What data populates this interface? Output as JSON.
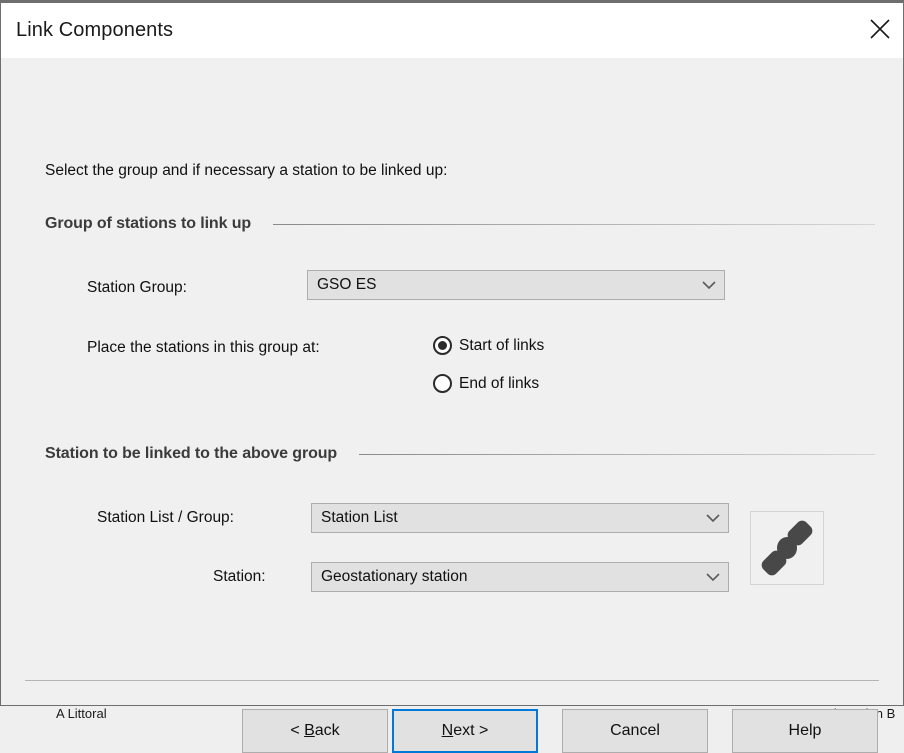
{
  "window": {
    "title": "Link Components",
    "close_icon": "close-icon"
  },
  "body": {
    "intro": "Select the group and if necessary a station to be linked up:"
  },
  "sections": [
    {
      "id": "group-of-stations",
      "title": "Group of stations to link up"
    },
    {
      "id": "station-to-be-linked",
      "title": "Station to be linked to the above group"
    }
  ],
  "fields": {
    "station_group": {
      "label": "Station Group:",
      "value": "GSO ES",
      "arrow_icon": "chevron-down-icon"
    },
    "place_stations": {
      "label": "Place the stations in this group at:",
      "options": [
        {
          "label": "Start of links",
          "selected": true
        },
        {
          "label": "End of links",
          "selected": false
        }
      ]
    },
    "station_list_group": {
      "label": "Station List / Group:",
      "value": "Station List",
      "arrow_icon": "chevron-down-icon"
    },
    "station": {
      "label": "Station:",
      "value": "Geostationary station",
      "arrow_icon": "chevron-down-icon"
    },
    "link_icon_button": {
      "icon": "link-chain-icon"
    }
  },
  "footer": {
    "buttons": [
      {
        "id": "back",
        "prefix": "< ",
        "accel": "B",
        "suffix": "ack",
        "default": false
      },
      {
        "id": "next",
        "prefix": "",
        "accel": "N",
        "suffix": "ext >",
        "default": true
      },
      {
        "id": "cancel",
        "prefix": "",
        "accel": "",
        "suffix": "Cancel",
        "default": false
      },
      {
        "id": "help",
        "prefix": "",
        "accel": "",
        "suffix": "Help",
        "default": false
      }
    ]
  },
  "background_window": {
    "fragment_left": "A   Littoral",
    "fragment_right": "Earth station B"
  },
  "colors": {
    "accent": "#0078d7",
    "dialog_bg": "#f0f0f0",
    "titlebar_bg": "#ffffff",
    "control_bg": "#e1e1e1",
    "control_border": "#adadad",
    "icon_dark": "#484848"
  }
}
